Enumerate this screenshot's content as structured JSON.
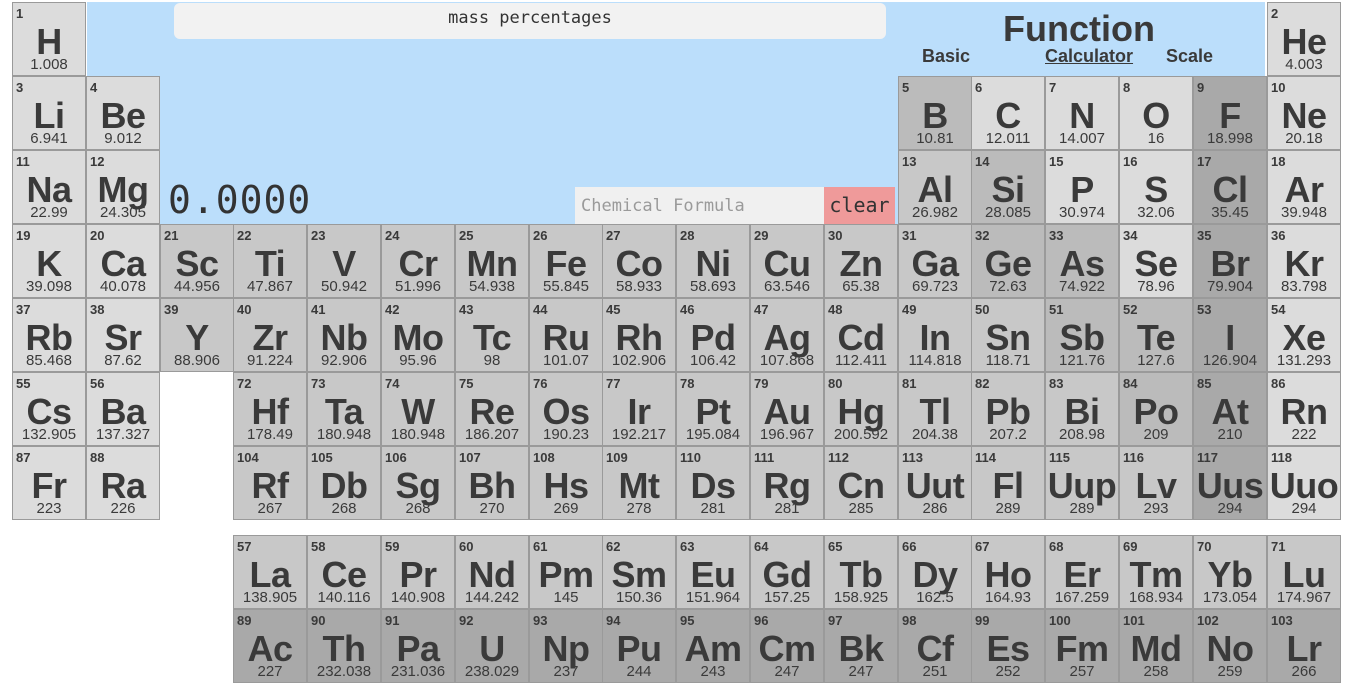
{
  "calculator": {
    "mode_title": "mass percentages",
    "result": "0.0000",
    "input_placeholder": "Chemical Formula",
    "input_value": "",
    "clear_label": "clear"
  },
  "function_panel": {
    "title": "Function",
    "tabs": [
      {
        "label": "Basic",
        "active": false
      },
      {
        "label": "Calculator",
        "active": true
      },
      {
        "label": "Scale",
        "active": false
      }
    ]
  },
  "colors": {
    "panel_bg": "#bbdefb",
    "clear_button": "#ef9a9a",
    "tone_a": "#dcdcdc",
    "tone_b": "#c8c8c8",
    "tone_c": "#bbbbbb",
    "tone_d": "#a9a9a9"
  },
  "elements": [
    {
      "n": "1",
      "s": "H",
      "m": "1.008",
      "r": 1,
      "c": 1,
      "t": "a"
    },
    {
      "n": "2",
      "s": "He",
      "m": "4.003",
      "r": 1,
      "c": 18,
      "t": "a"
    },
    {
      "n": "3",
      "s": "Li",
      "m": "6.941",
      "r": 2,
      "c": 1,
      "t": "a"
    },
    {
      "n": "4",
      "s": "Be",
      "m": "9.012",
      "r": 2,
      "c": 2,
      "t": "a"
    },
    {
      "n": "5",
      "s": "B",
      "m": "10.81",
      "r": 2,
      "c": 13,
      "t": "c"
    },
    {
      "n": "6",
      "s": "C",
      "m": "12.011",
      "r": 2,
      "c": 14,
      "t": "a"
    },
    {
      "n": "7",
      "s": "N",
      "m": "14.007",
      "r": 2,
      "c": 15,
      "t": "a"
    },
    {
      "n": "8",
      "s": "O",
      "m": "16",
      "r": 2,
      "c": 16,
      "t": "a"
    },
    {
      "n": "9",
      "s": "F",
      "m": "18.998",
      "r": 2,
      "c": 17,
      "t": "d"
    },
    {
      "n": "10",
      "s": "Ne",
      "m": "20.18",
      "r": 2,
      "c": 18,
      "t": "a"
    },
    {
      "n": "11",
      "s": "Na",
      "m": "22.99",
      "r": 3,
      "c": 1,
      "t": "a"
    },
    {
      "n": "12",
      "s": "Mg",
      "m": "24.305",
      "r": 3,
      "c": 2,
      "t": "a"
    },
    {
      "n": "13",
      "s": "Al",
      "m": "26.982",
      "r": 3,
      "c": 13,
      "t": "b"
    },
    {
      "n": "14",
      "s": "Si",
      "m": "28.085",
      "r": 3,
      "c": 14,
      "t": "c"
    },
    {
      "n": "15",
      "s": "P",
      "m": "30.974",
      "r": 3,
      "c": 15,
      "t": "a"
    },
    {
      "n": "16",
      "s": "S",
      "m": "32.06",
      "r": 3,
      "c": 16,
      "t": "a"
    },
    {
      "n": "17",
      "s": "Cl",
      "m": "35.45",
      "r": 3,
      "c": 17,
      "t": "d"
    },
    {
      "n": "18",
      "s": "Ar",
      "m": "39.948",
      "r": 3,
      "c": 18,
      "t": "a"
    },
    {
      "n": "19",
      "s": "K",
      "m": "39.098",
      "r": 4,
      "c": 1,
      "t": "a"
    },
    {
      "n": "20",
      "s": "Ca",
      "m": "40.078",
      "r": 4,
      "c": 2,
      "t": "a"
    },
    {
      "n": "21",
      "s": "Sc",
      "m": "44.956",
      "r": 4,
      "c": 3,
      "t": "b"
    },
    {
      "n": "22",
      "s": "Ti",
      "m": "47.867",
      "r": 4,
      "c": 4,
      "t": "b"
    },
    {
      "n": "23",
      "s": "V",
      "m": "50.942",
      "r": 4,
      "c": 5,
      "t": "b"
    },
    {
      "n": "24",
      "s": "Cr",
      "m": "51.996",
      "r": 4,
      "c": 6,
      "t": "b"
    },
    {
      "n": "25",
      "s": "Mn",
      "m": "54.938",
      "r": 4,
      "c": 7,
      "t": "b"
    },
    {
      "n": "26",
      "s": "Fe",
      "m": "55.845",
      "r": 4,
      "c": 8,
      "t": "b"
    },
    {
      "n": "27",
      "s": "Co",
      "m": "58.933",
      "r": 4,
      "c": 9,
      "t": "b"
    },
    {
      "n": "28",
      "s": "Ni",
      "m": "58.693",
      "r": 4,
      "c": 10,
      "t": "b"
    },
    {
      "n": "29",
      "s": "Cu",
      "m": "63.546",
      "r": 4,
      "c": 11,
      "t": "b"
    },
    {
      "n": "30",
      "s": "Zn",
      "m": "65.38",
      "r": 4,
      "c": 12,
      "t": "b"
    },
    {
      "n": "31",
      "s": "Ga",
      "m": "69.723",
      "r": 4,
      "c": 13,
      "t": "b"
    },
    {
      "n": "32",
      "s": "Ge",
      "m": "72.63",
      "r": 4,
      "c": 14,
      "t": "c"
    },
    {
      "n": "33",
      "s": "As",
      "m": "74.922",
      "r": 4,
      "c": 15,
      "t": "c"
    },
    {
      "n": "34",
      "s": "Se",
      "m": "78.96",
      "r": 4,
      "c": 16,
      "t": "a"
    },
    {
      "n": "35",
      "s": "Br",
      "m": "79.904",
      "r": 4,
      "c": 17,
      "t": "d"
    },
    {
      "n": "36",
      "s": "Kr",
      "m": "83.798",
      "r": 4,
      "c": 18,
      "t": "a"
    },
    {
      "n": "37",
      "s": "Rb",
      "m": "85.468",
      "r": 5,
      "c": 1,
      "t": "a"
    },
    {
      "n": "38",
      "s": "Sr",
      "m": "87.62",
      "r": 5,
      "c": 2,
      "t": "a"
    },
    {
      "n": "39",
      "s": "Y",
      "m": "88.906",
      "r": 5,
      "c": 3,
      "t": "b"
    },
    {
      "n": "40",
      "s": "Zr",
      "m": "91.224",
      "r": 5,
      "c": 4,
      "t": "b"
    },
    {
      "n": "41",
      "s": "Nb",
      "m": "92.906",
      "r": 5,
      "c": 5,
      "t": "b"
    },
    {
      "n": "42",
      "s": "Mo",
      "m": "95.96",
      "r": 5,
      "c": 6,
      "t": "b"
    },
    {
      "n": "43",
      "s": "Tc",
      "m": "98",
      "r": 5,
      "c": 7,
      "t": "b"
    },
    {
      "n": "44",
      "s": "Ru",
      "m": "101.07",
      "r": 5,
      "c": 8,
      "t": "b"
    },
    {
      "n": "45",
      "s": "Rh",
      "m": "102.906",
      "r": 5,
      "c": 9,
      "t": "b"
    },
    {
      "n": "46",
      "s": "Pd",
      "m": "106.42",
      "r": 5,
      "c": 10,
      "t": "b"
    },
    {
      "n": "47",
      "s": "Ag",
      "m": "107.868",
      "r": 5,
      "c": 11,
      "t": "b"
    },
    {
      "n": "48",
      "s": "Cd",
      "m": "112.411",
      "r": 5,
      "c": 12,
      "t": "b"
    },
    {
      "n": "49",
      "s": "In",
      "m": "114.818",
      "r": 5,
      "c": 13,
      "t": "b"
    },
    {
      "n": "50",
      "s": "Sn",
      "m": "118.71",
      "r": 5,
      "c": 14,
      "t": "b"
    },
    {
      "n": "51",
      "s": "Sb",
      "m": "121.76",
      "r": 5,
      "c": 15,
      "t": "c"
    },
    {
      "n": "52",
      "s": "Te",
      "m": "127.6",
      "r": 5,
      "c": 16,
      "t": "c"
    },
    {
      "n": "53",
      "s": "I",
      "m": "126.904",
      "r": 5,
      "c": 17,
      "t": "d"
    },
    {
      "n": "54",
      "s": "Xe",
      "m": "131.293",
      "r": 5,
      "c": 18,
      "t": "a"
    },
    {
      "n": "55",
      "s": "Cs",
      "m": "132.905",
      "r": 6,
      "c": 1,
      "t": "a"
    },
    {
      "n": "56",
      "s": "Ba",
      "m": "137.327",
      "r": 6,
      "c": 2,
      "t": "a"
    },
    {
      "n": "72",
      "s": "Hf",
      "m": "178.49",
      "r": 6,
      "c": 4,
      "t": "b"
    },
    {
      "n": "73",
      "s": "Ta",
      "m": "180.948",
      "r": 6,
      "c": 5,
      "t": "b"
    },
    {
      "n": "74",
      "s": "W",
      "m": "180.948",
      "r": 6,
      "c": 6,
      "t": "b"
    },
    {
      "n": "75",
      "s": "Re",
      "m": "186.207",
      "r": 6,
      "c": 7,
      "t": "b"
    },
    {
      "n": "76",
      "s": "Os",
      "m": "190.23",
      "r": 6,
      "c": 8,
      "t": "b"
    },
    {
      "n": "77",
      "s": "Ir",
      "m": "192.217",
      "r": 6,
      "c": 9,
      "t": "b"
    },
    {
      "n": "78",
      "s": "Pt",
      "m": "195.084",
      "r": 6,
      "c": 10,
      "t": "b"
    },
    {
      "n": "79",
      "s": "Au",
      "m": "196.967",
      "r": 6,
      "c": 11,
      "t": "b"
    },
    {
      "n": "80",
      "s": "Hg",
      "m": "200.592",
      "r": 6,
      "c": 12,
      "t": "b"
    },
    {
      "n": "81",
      "s": "Tl",
      "m": "204.38",
      "r": 6,
      "c": 13,
      "t": "b"
    },
    {
      "n": "82",
      "s": "Pb",
      "m": "207.2",
      "r": 6,
      "c": 14,
      "t": "b"
    },
    {
      "n": "83",
      "s": "Bi",
      "m": "208.98",
      "r": 6,
      "c": 15,
      "t": "b"
    },
    {
      "n": "84",
      "s": "Po",
      "m": "209",
      "r": 6,
      "c": 16,
      "t": "c"
    },
    {
      "n": "85",
      "s": "At",
      "m": "210",
      "r": 6,
      "c": 17,
      "t": "d"
    },
    {
      "n": "86",
      "s": "Rn",
      "m": "222",
      "r": 6,
      "c": 18,
      "t": "a"
    },
    {
      "n": "87",
      "s": "Fr",
      "m": "223",
      "r": 7,
      "c": 1,
      "t": "a"
    },
    {
      "n": "88",
      "s": "Ra",
      "m": "226",
      "r": 7,
      "c": 2,
      "t": "a"
    },
    {
      "n": "104",
      "s": "Rf",
      "m": "267",
      "r": 7,
      "c": 4,
      "t": "b"
    },
    {
      "n": "105",
      "s": "Db",
      "m": "268",
      "r": 7,
      "c": 5,
      "t": "b"
    },
    {
      "n": "106",
      "s": "Sg",
      "m": "268",
      "r": 7,
      "c": 6,
      "t": "b"
    },
    {
      "n": "107",
      "s": "Bh",
      "m": "270",
      "r": 7,
      "c": 7,
      "t": "b"
    },
    {
      "n": "108",
      "s": "Hs",
      "m": "269",
      "r": 7,
      "c": 8,
      "t": "b"
    },
    {
      "n": "109",
      "s": "Mt",
      "m": "278",
      "r": 7,
      "c": 9,
      "t": "b"
    },
    {
      "n": "110",
      "s": "Ds",
      "m": "281",
      "r": 7,
      "c": 10,
      "t": "b"
    },
    {
      "n": "111",
      "s": "Rg",
      "m": "281",
      "r": 7,
      "c": 11,
      "t": "b"
    },
    {
      "n": "112",
      "s": "Cn",
      "m": "285",
      "r": 7,
      "c": 12,
      "t": "b"
    },
    {
      "n": "113",
      "s": "Uut",
      "m": "286",
      "r": 7,
      "c": 13,
      "t": "b"
    },
    {
      "n": "114",
      "s": "Fl",
      "m": "289",
      "r": 7,
      "c": 14,
      "t": "b"
    },
    {
      "n": "115",
      "s": "Uup",
      "m": "289",
      "r": 7,
      "c": 15,
      "t": "b"
    },
    {
      "n": "116",
      "s": "Lv",
      "m": "293",
      "r": 7,
      "c": 16,
      "t": "b"
    },
    {
      "n": "117",
      "s": "Uus",
      "m": "294",
      "r": 7,
      "c": 17,
      "t": "d"
    },
    {
      "n": "118",
      "s": "Uuo",
      "m": "294",
      "r": 7,
      "c": 18,
      "t": "a"
    },
    {
      "n": "57",
      "s": "La",
      "m": "138.905",
      "r": 8,
      "c": 4,
      "t": "b"
    },
    {
      "n": "58",
      "s": "Ce",
      "m": "140.116",
      "r": 8,
      "c": 5,
      "t": "b"
    },
    {
      "n": "59",
      "s": "Pr",
      "m": "140.908",
      "r": 8,
      "c": 6,
      "t": "b"
    },
    {
      "n": "60",
      "s": "Nd",
      "m": "144.242",
      "r": 8,
      "c": 7,
      "t": "b"
    },
    {
      "n": "61",
      "s": "Pm",
      "m": "145",
      "r": 8,
      "c": 8,
      "t": "b"
    },
    {
      "n": "62",
      "s": "Sm",
      "m": "150.36",
      "r": 8,
      "c": 9,
      "t": "b"
    },
    {
      "n": "63",
      "s": "Eu",
      "m": "151.964",
      "r": 8,
      "c": 10,
      "t": "b"
    },
    {
      "n": "64",
      "s": "Gd",
      "m": "157.25",
      "r": 8,
      "c": 11,
      "t": "b"
    },
    {
      "n": "65",
      "s": "Tb",
      "m": "158.925",
      "r": 8,
      "c": 12,
      "t": "b"
    },
    {
      "n": "66",
      "s": "Dy",
      "m": "162.5",
      "r": 8,
      "c": 13,
      "t": "b"
    },
    {
      "n": "67",
      "s": "Ho",
      "m": "164.93",
      "r": 8,
      "c": 14,
      "t": "b"
    },
    {
      "n": "68",
      "s": "Er",
      "m": "167.259",
      "r": 8,
      "c": 15,
      "t": "b"
    },
    {
      "n": "69",
      "s": "Tm",
      "m": "168.934",
      "r": 8,
      "c": 16,
      "t": "b"
    },
    {
      "n": "70",
      "s": "Yb",
      "m": "173.054",
      "r": 8,
      "c": 17,
      "t": "b"
    },
    {
      "n": "71",
      "s": "Lu",
      "m": "174.967",
      "r": 8,
      "c": 18,
      "t": "b"
    },
    {
      "n": "89",
      "s": "Ac",
      "m": "227",
      "r": 9,
      "c": 4,
      "t": "d"
    },
    {
      "n": "90",
      "s": "Th",
      "m": "232.038",
      "r": 9,
      "c": 5,
      "t": "d"
    },
    {
      "n": "91",
      "s": "Pa",
      "m": "231.036",
      "r": 9,
      "c": 6,
      "t": "d"
    },
    {
      "n": "92",
      "s": "U",
      "m": "238.029",
      "r": 9,
      "c": 7,
      "t": "d"
    },
    {
      "n": "93",
      "s": "Np",
      "m": "237",
      "r": 9,
      "c": 8,
      "t": "d"
    },
    {
      "n": "94",
      "s": "Pu",
      "m": "244",
      "r": 9,
      "c": 9,
      "t": "d"
    },
    {
      "n": "95",
      "s": "Am",
      "m": "243",
      "r": 9,
      "c": 10,
      "t": "d"
    },
    {
      "n": "96",
      "s": "Cm",
      "m": "247",
      "r": 9,
      "c": 11,
      "t": "d"
    },
    {
      "n": "97",
      "s": "Bk",
      "m": "247",
      "r": 9,
      "c": 12,
      "t": "d"
    },
    {
      "n": "98",
      "s": "Cf",
      "m": "251",
      "r": 9,
      "c": 13,
      "t": "d"
    },
    {
      "n": "99",
      "s": "Es",
      "m": "252",
      "r": 9,
      "c": 14,
      "t": "d"
    },
    {
      "n": "100",
      "s": "Fm",
      "m": "257",
      "r": 9,
      "c": 15,
      "t": "d"
    },
    {
      "n": "101",
      "s": "Md",
      "m": "258",
      "r": 9,
      "c": 16,
      "t": "d"
    },
    {
      "n": "102",
      "s": "No",
      "m": "259",
      "r": 9,
      "c": 17,
      "t": "d"
    },
    {
      "n": "103",
      "s": "Lr",
      "m": "266",
      "r": 9,
      "c": 18,
      "t": "d"
    }
  ]
}
